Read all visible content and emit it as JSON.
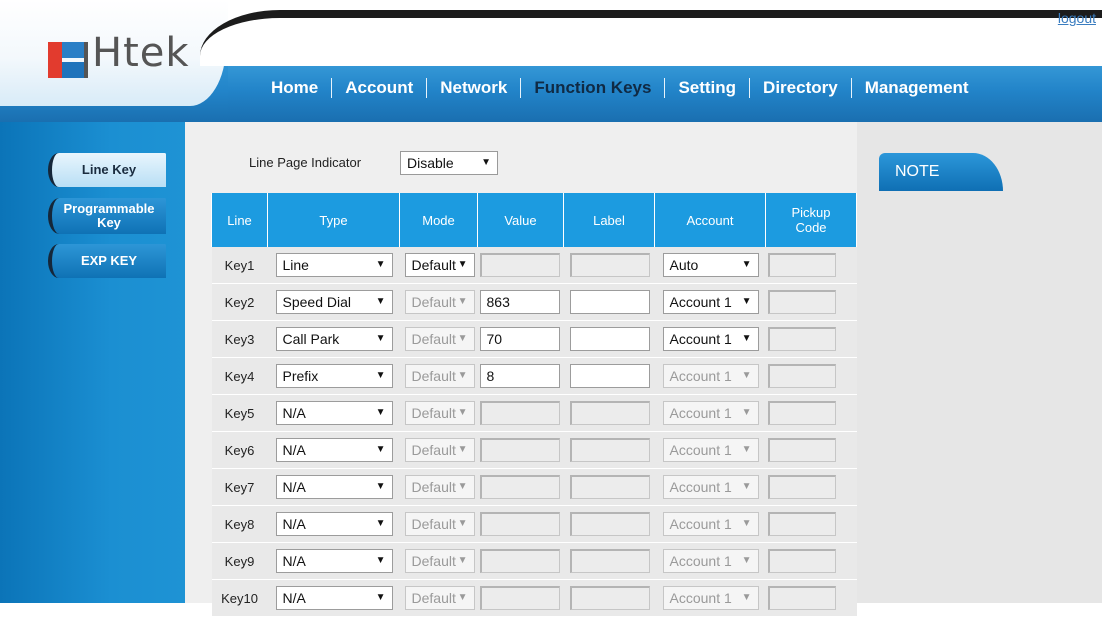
{
  "header": {
    "logo_text": "Htek",
    "logout": "logout",
    "nav": [
      {
        "label": "Home"
      },
      {
        "label": "Account"
      },
      {
        "label": "Network"
      },
      {
        "label": "Function Keys"
      },
      {
        "label": "Setting"
      },
      {
        "label": "Directory"
      },
      {
        "label": "Management"
      }
    ]
  },
  "sidebar": {
    "items": [
      {
        "label": "Line Key"
      },
      {
        "label": "Programmable Key"
      },
      {
        "label": "EXP KEY"
      }
    ]
  },
  "line_page_indicator": {
    "label": "Line Page Indicator",
    "value": "Disable"
  },
  "table": {
    "headers": [
      "Line",
      "Type",
      "Mode",
      "Value",
      "Label",
      "Account",
      "Pickup Code"
    ],
    "rows": [
      {
        "key": "Key1",
        "type": "Line",
        "mode": "Default",
        "value": "",
        "label": "",
        "account": "Auto"
      },
      {
        "key": "Key2",
        "type": "Speed Dial",
        "mode": "Default",
        "value": "863",
        "label": "",
        "account": "Account 1"
      },
      {
        "key": "Key3",
        "type": "Call Park",
        "mode": "Default",
        "value": "70",
        "label": "",
        "account": "Account 1"
      },
      {
        "key": "Key4",
        "type": "Prefix",
        "mode": "Default",
        "value": "8",
        "label": "",
        "account": "Account 1"
      },
      {
        "key": "Key5",
        "type": "N/A",
        "mode": "Default",
        "value": "",
        "label": "",
        "account": "Account 1"
      },
      {
        "key": "Key6",
        "type": "N/A",
        "mode": "Default",
        "value": "",
        "label": "",
        "account": "Account 1"
      },
      {
        "key": "Key7",
        "type": "N/A",
        "mode": "Default",
        "value": "",
        "label": "",
        "account": "Account 1"
      },
      {
        "key": "Key8",
        "type": "N/A",
        "mode": "Default",
        "value": "",
        "label": "",
        "account": "Account 1"
      },
      {
        "key": "Key9",
        "type": "N/A",
        "mode": "Default",
        "value": "",
        "label": "",
        "account": "Account 1"
      },
      {
        "key": "Key10",
        "type": "N/A",
        "mode": "Default",
        "value": "",
        "label": "",
        "account": "Account 1"
      }
    ]
  },
  "note": {
    "title": "NOTE"
  },
  "colors": {
    "header_blue": "#2284c9",
    "table_header": "#1c9be0",
    "active_nav": "#102a44"
  }
}
